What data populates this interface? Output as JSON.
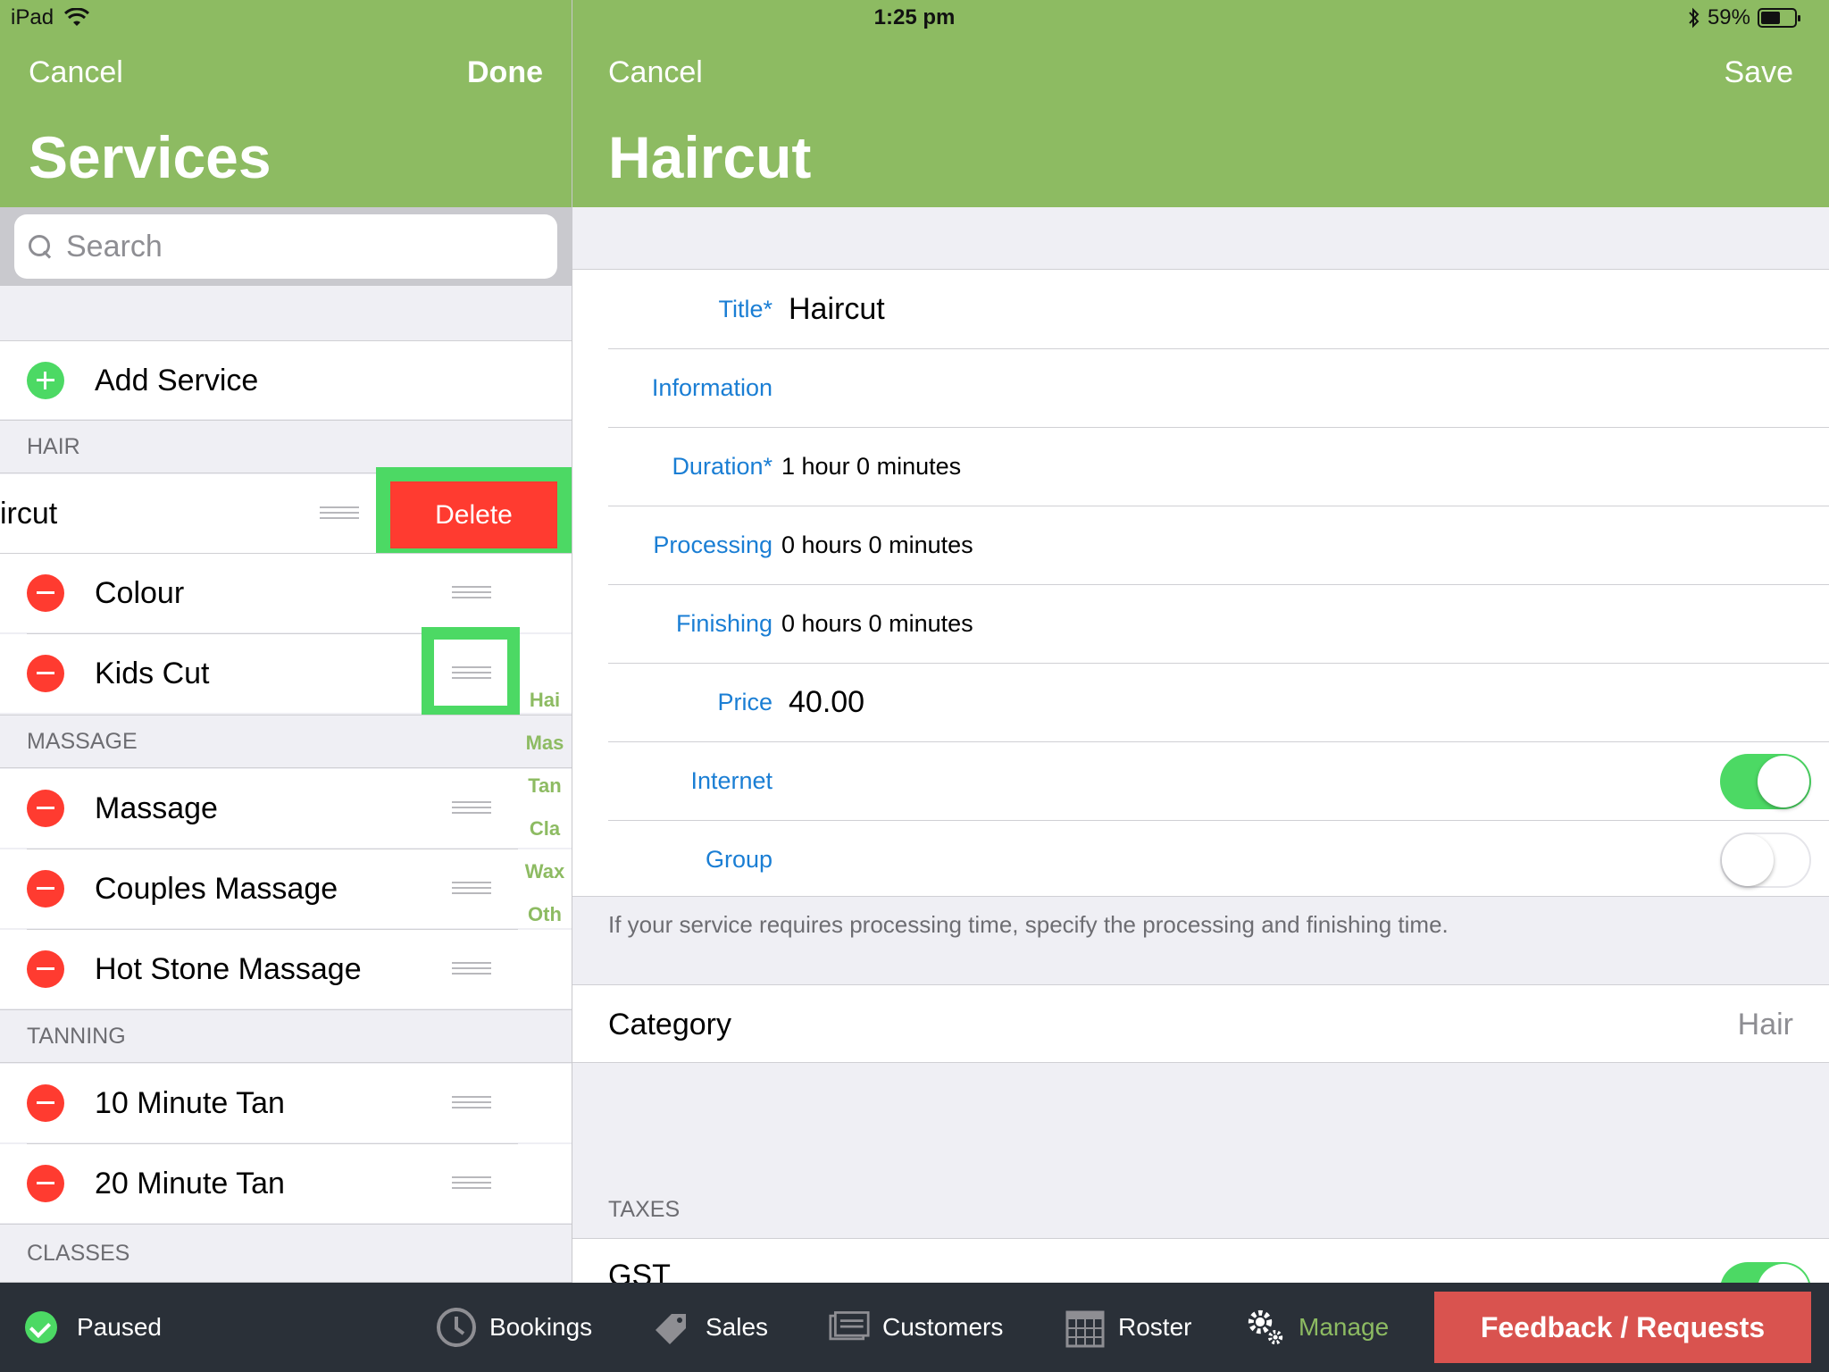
{
  "status_bar": {
    "device": "iPad",
    "time": "1:25 pm",
    "battery": "59%",
    "battery_level": 0.59
  },
  "left_nav": {
    "cancel": "Cancel",
    "done": "Done",
    "title": "Services"
  },
  "right_nav": {
    "cancel": "Cancel",
    "save": "Save",
    "title": "Haircut"
  },
  "search": {
    "placeholder": "Search"
  },
  "add_service": "Add Service",
  "sections": {
    "hair": {
      "header": "HAIR",
      "swiped_item": "ircut",
      "delete_label": "Delete",
      "items": [
        "Colour",
        "Kids Cut"
      ]
    },
    "massage": {
      "header": "MASSAGE",
      "items": [
        "Massage",
        "Couples Massage",
        "Hot Stone Massage"
      ]
    },
    "tanning": {
      "header": "TANNING",
      "items": [
        "10 Minute Tan",
        "20 Minute Tan"
      ]
    },
    "classes": {
      "header": "CLASSES"
    }
  },
  "index": [
    "Hai",
    "Mas",
    "Tan",
    "Cla",
    "Wax",
    "Oth"
  ],
  "form": {
    "title": {
      "label": "Title*",
      "value": "Haircut"
    },
    "information": {
      "label": "Information",
      "value": ""
    },
    "duration": {
      "label": "Duration*",
      "value": "1 hour 0 minutes"
    },
    "processing": {
      "label": "Processing",
      "value": "0 hours 0 minutes"
    },
    "finishing": {
      "label": "Finishing",
      "value": "0 hours 0 minutes"
    },
    "price": {
      "label": "Price",
      "value": "40.00"
    },
    "internet": {
      "label": "Internet",
      "on": true
    },
    "group": {
      "label": "Group",
      "on": false
    }
  },
  "footnote": "If your service requires processing time, specify the processing and finishing time.",
  "category": {
    "label": "Category",
    "value": "Hair"
  },
  "taxes": {
    "header": "TAXES",
    "gst": "GST",
    "gst_on": true
  },
  "bottom_bar": {
    "status": "Paused",
    "tabs": [
      "Bookings",
      "Sales",
      "Customers",
      "Roster",
      "Manage"
    ],
    "active_tab": "Manage",
    "feedback": "Feedback / Requests"
  },
  "colors": {
    "accent_green": "#8dbb62",
    "delete_red": "#ff3b30",
    "toggle_green": "#4cd964",
    "label_blue": "#1a7ed4",
    "feedback_red": "#d9534f"
  }
}
